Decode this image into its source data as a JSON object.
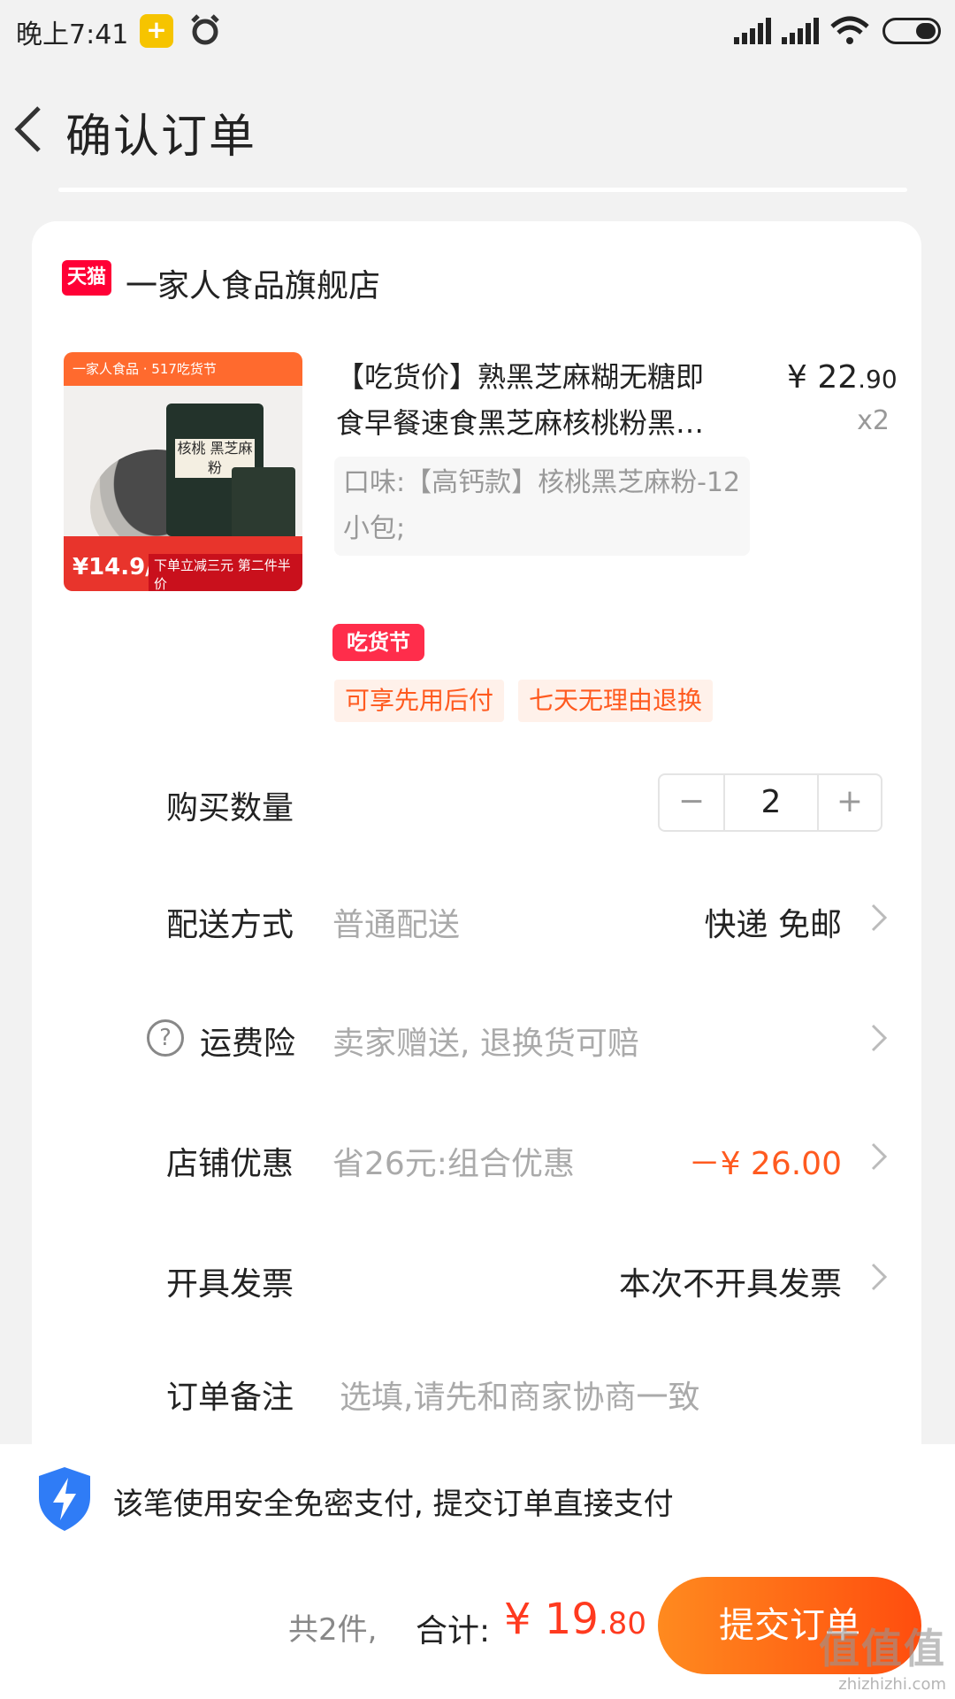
{
  "status_bar": {
    "time": "晚上7:41"
  },
  "header": {
    "title": "确认订单"
  },
  "store": {
    "badge": "天猫",
    "name": "一家人食品旗舰店"
  },
  "product": {
    "title_line1": "【吃货价】熟黑芝麻糊无糖即",
    "title_line2": "食早餐速食黑芝麻核桃粉黑…",
    "price_main": "¥ 22",
    "price_decimal": ".90",
    "quantity_text": "x2",
    "sku": "口味:【高钙款】核桃黑芝麻粉-12小包;",
    "festival_badge": "吃货节",
    "tags": [
      "可享先用后付",
      "七天无理由退换"
    ],
    "image": {
      "top_text": "一家人食品 · 517吃货节",
      "pack_label": "核桃 黑芝麻粉",
      "price": "¥14.9/盒",
      "promo": "下单立减三元 第二件半价"
    }
  },
  "rows": {
    "quantity": {
      "label": "购买数量",
      "value": "2",
      "minus": "−",
      "plus": "+"
    },
    "delivery": {
      "label": "配送方式",
      "sub": "普通配送",
      "value": "快递 免邮"
    },
    "shipping_insurance": {
      "label": "运费险",
      "sub": "卖家赠送, 退换货可赔"
    },
    "store_discount": {
      "label": "店铺优惠",
      "sub": "省26元:组合优惠",
      "value": "－¥ 26.00"
    },
    "invoice": {
      "label": "开具发票",
      "value": "本次不开具发票"
    },
    "note": {
      "label": "订单备注",
      "placeholder": "选填,请先和商家协商一致"
    }
  },
  "secure": {
    "text": "该笔使用安全免密支付, 提交订单直接支付"
  },
  "footer": {
    "count": "共2件,",
    "total_label": "合计:",
    "total_main": "¥ 19",
    "total_decimal": ".80",
    "submit": "提交订单"
  },
  "watermark": {
    "big": "值值值",
    "small": "zhizhizhi.com"
  },
  "colors": {
    "accent": "#ff5a1f",
    "price": "#ff3a1f",
    "tmall": "#ff0036"
  }
}
